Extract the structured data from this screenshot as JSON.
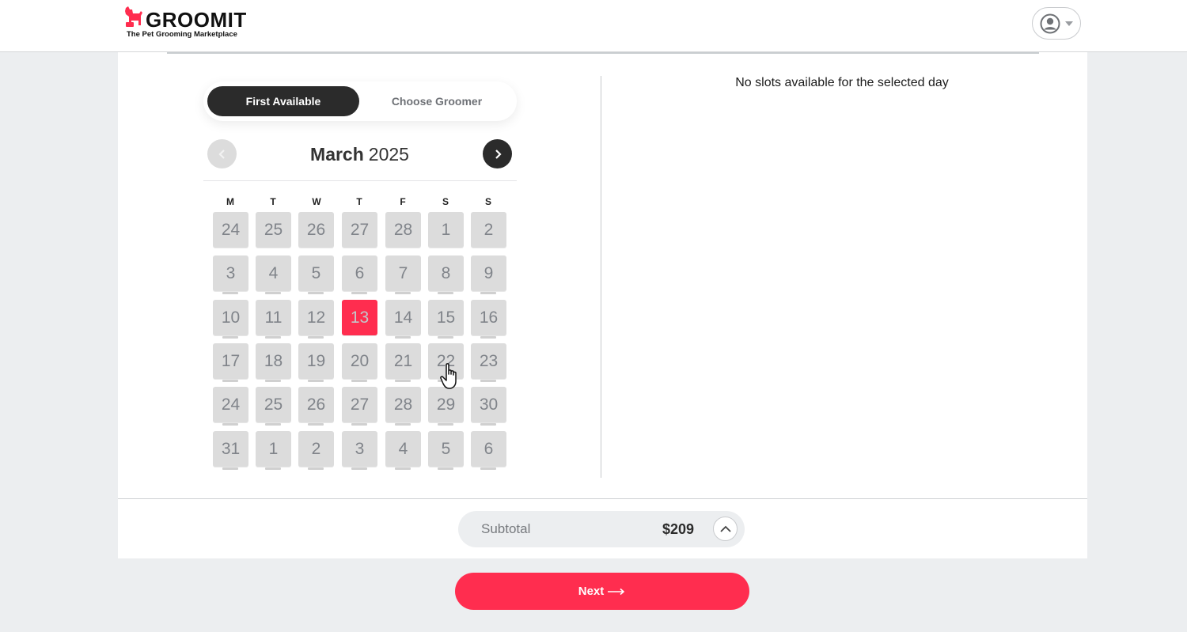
{
  "brand": {
    "name": "GROOMIT",
    "tagline": "The Pet Grooming Marketplace",
    "accent": "#ff2d4f",
    "dark": "#2b2b2b"
  },
  "header": {
    "account_icon": "user-circle-icon",
    "account_caret_icon": "caret-down-icon"
  },
  "toggle": {
    "options": [
      {
        "label": "First Available",
        "active": true
      },
      {
        "label": "Choose Groomer",
        "active": false
      }
    ]
  },
  "calendar": {
    "month": "March",
    "year": "2025",
    "prev_icon": "chevron-left-icon",
    "next_icon": "chevron-right-icon",
    "weekdays": [
      "M",
      "T",
      "W",
      "T",
      "F",
      "S",
      "S"
    ],
    "weeks": [
      [
        "24",
        "25",
        "26",
        "27",
        "28",
        "1",
        "2"
      ],
      [
        "3",
        "4",
        "5",
        "6",
        "7",
        "8",
        "9"
      ],
      [
        "10",
        "11",
        "12",
        "13",
        "14",
        "15",
        "16"
      ],
      [
        "17",
        "18",
        "19",
        "20",
        "21",
        "22",
        "23"
      ],
      [
        "24",
        "25",
        "26",
        "27",
        "28",
        "29",
        "30"
      ],
      [
        "31",
        "1",
        "2",
        "3",
        "4",
        "5",
        "6"
      ]
    ],
    "selected": {
      "week": 2,
      "day": 3
    }
  },
  "slots": {
    "message": "No slots available for the selected day"
  },
  "subtotal": {
    "label": "Subtotal",
    "value": "$209",
    "toggle_icon": "chevron-up-icon"
  },
  "next_button": {
    "label": "Next",
    "icon": "arrow-right-icon"
  }
}
